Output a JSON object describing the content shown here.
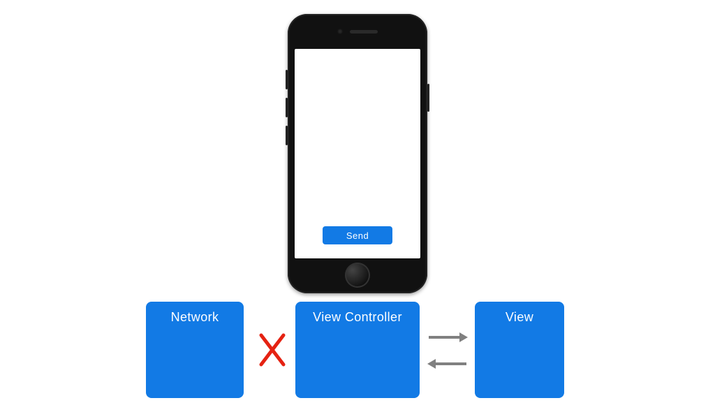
{
  "phone": {
    "button_label": "Send"
  },
  "boxes": {
    "network": "Network",
    "view_controller": "View Controller",
    "view": "View"
  },
  "connectors": {
    "network_vc": "blocked",
    "vc_view": "bidirectional"
  },
  "colors": {
    "accent": "#127ae5",
    "error": "#e52212",
    "arrow": "#808080"
  }
}
